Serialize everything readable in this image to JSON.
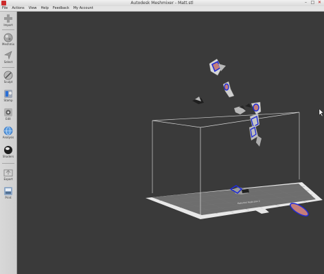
{
  "window": {
    "title": "Autodesk Meshmixer - Matt.stl",
    "min_glyph": "–",
    "max_glyph": "□",
    "close_glyph": "✕"
  },
  "menu": [
    {
      "label": "File"
    },
    {
      "label": "Actions"
    },
    {
      "label": "View"
    },
    {
      "label": "Help"
    },
    {
      "label": "Feedback"
    },
    {
      "label": "My Account"
    }
  ],
  "toolbar": {
    "tools": [
      {
        "label": "Import",
        "icon": "plus-icon"
      },
      {
        "label": "Meshmix",
        "icon": "sphere-icon"
      },
      {
        "label": "Select",
        "icon": "arrow-cursor-icon"
      },
      {
        "label": "Sculpt",
        "icon": "brush-icon"
      },
      {
        "label": "Stamp",
        "icon": "stamp-icon"
      },
      {
        "label": "Edit",
        "icon": "edit-icon"
      },
      {
        "label": "Analysis",
        "icon": "globe-icon"
      },
      {
        "label": "Shaders",
        "icon": "shader-ball-icon"
      },
      {
        "label": "Export",
        "icon": "export-icon"
      },
      {
        "label": "Print",
        "icon": "print-icon"
      }
    ]
  },
  "viewport": {
    "bed_label": "Makerbot Replicator 2",
    "colors": {
      "background": "#3a3a3a",
      "bed_surface": "#6e6e6e",
      "bed_border": "#e8e8e8",
      "bounding_box": "#d8d8d8",
      "mesh": "#c9c9c9",
      "selection": "#1f2bd6",
      "selection_fill": "#c47d7a"
    }
  }
}
